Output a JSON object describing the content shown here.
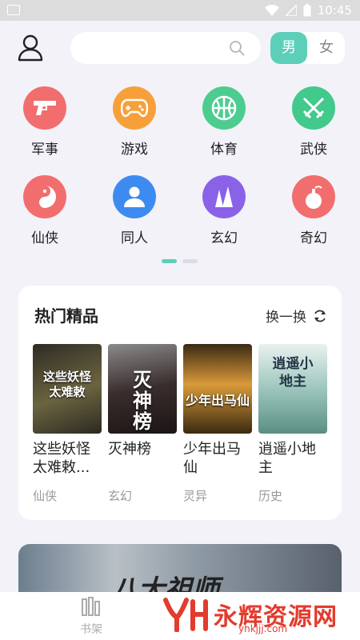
{
  "status_bar": {
    "time": "10:45"
  },
  "search": {
    "placeholder": ""
  },
  "gender": {
    "male": "男",
    "female": "女"
  },
  "categories": [
    {
      "label": "军事",
      "icon": "gun-icon",
      "color": "#f26d6d"
    },
    {
      "label": "游戏",
      "icon": "gamepad-icon",
      "color": "#f7a03a"
    },
    {
      "label": "体育",
      "icon": "basketball-icon",
      "color": "#4ccd8f"
    },
    {
      "label": "武侠",
      "icon": "crossed-swords-icon",
      "color": "#42c98c"
    },
    {
      "label": "仙侠",
      "icon": "yin-yang-icon",
      "color": "#f26d6d"
    },
    {
      "label": "同人",
      "icon": "person-icon",
      "color": "#3d8bf0"
    },
    {
      "label": "玄幻",
      "icon": "peaks-icon",
      "color": "#8a62e8"
    },
    {
      "label": "奇幻",
      "icon": "gourd-icon",
      "color": "#f26d6d"
    }
  ],
  "pager": {
    "active_color": "#5dcfb8"
  },
  "hot": {
    "title": "热门精品",
    "refresh_label": "换一换",
    "books": [
      {
        "title": "这些妖怪太难敕...",
        "category": "仙侠",
        "cover_text": "这些妖怪太难敕",
        "cover_color": "#3b3a2e"
      },
      {
        "title": "灭神榜",
        "category": "玄幻",
        "cover_text": "灭神榜",
        "cover_color": "#4a3a3a"
      },
      {
        "title": "少年出马仙",
        "category": "灵异",
        "cover_text": "少年出马仙",
        "cover_color": "#6a4a1e"
      },
      {
        "title": "逍遥小地主",
        "category": "历史",
        "cover_text": "逍遥小地主",
        "cover_color": "#7fa9a0"
      }
    ]
  },
  "banner": {
    "text": "八大祖师"
  },
  "tabbar": {
    "bookshelf": "书架"
  },
  "watermark": {
    "name": "永辉资源网",
    "url": "yhkjjj.com"
  }
}
